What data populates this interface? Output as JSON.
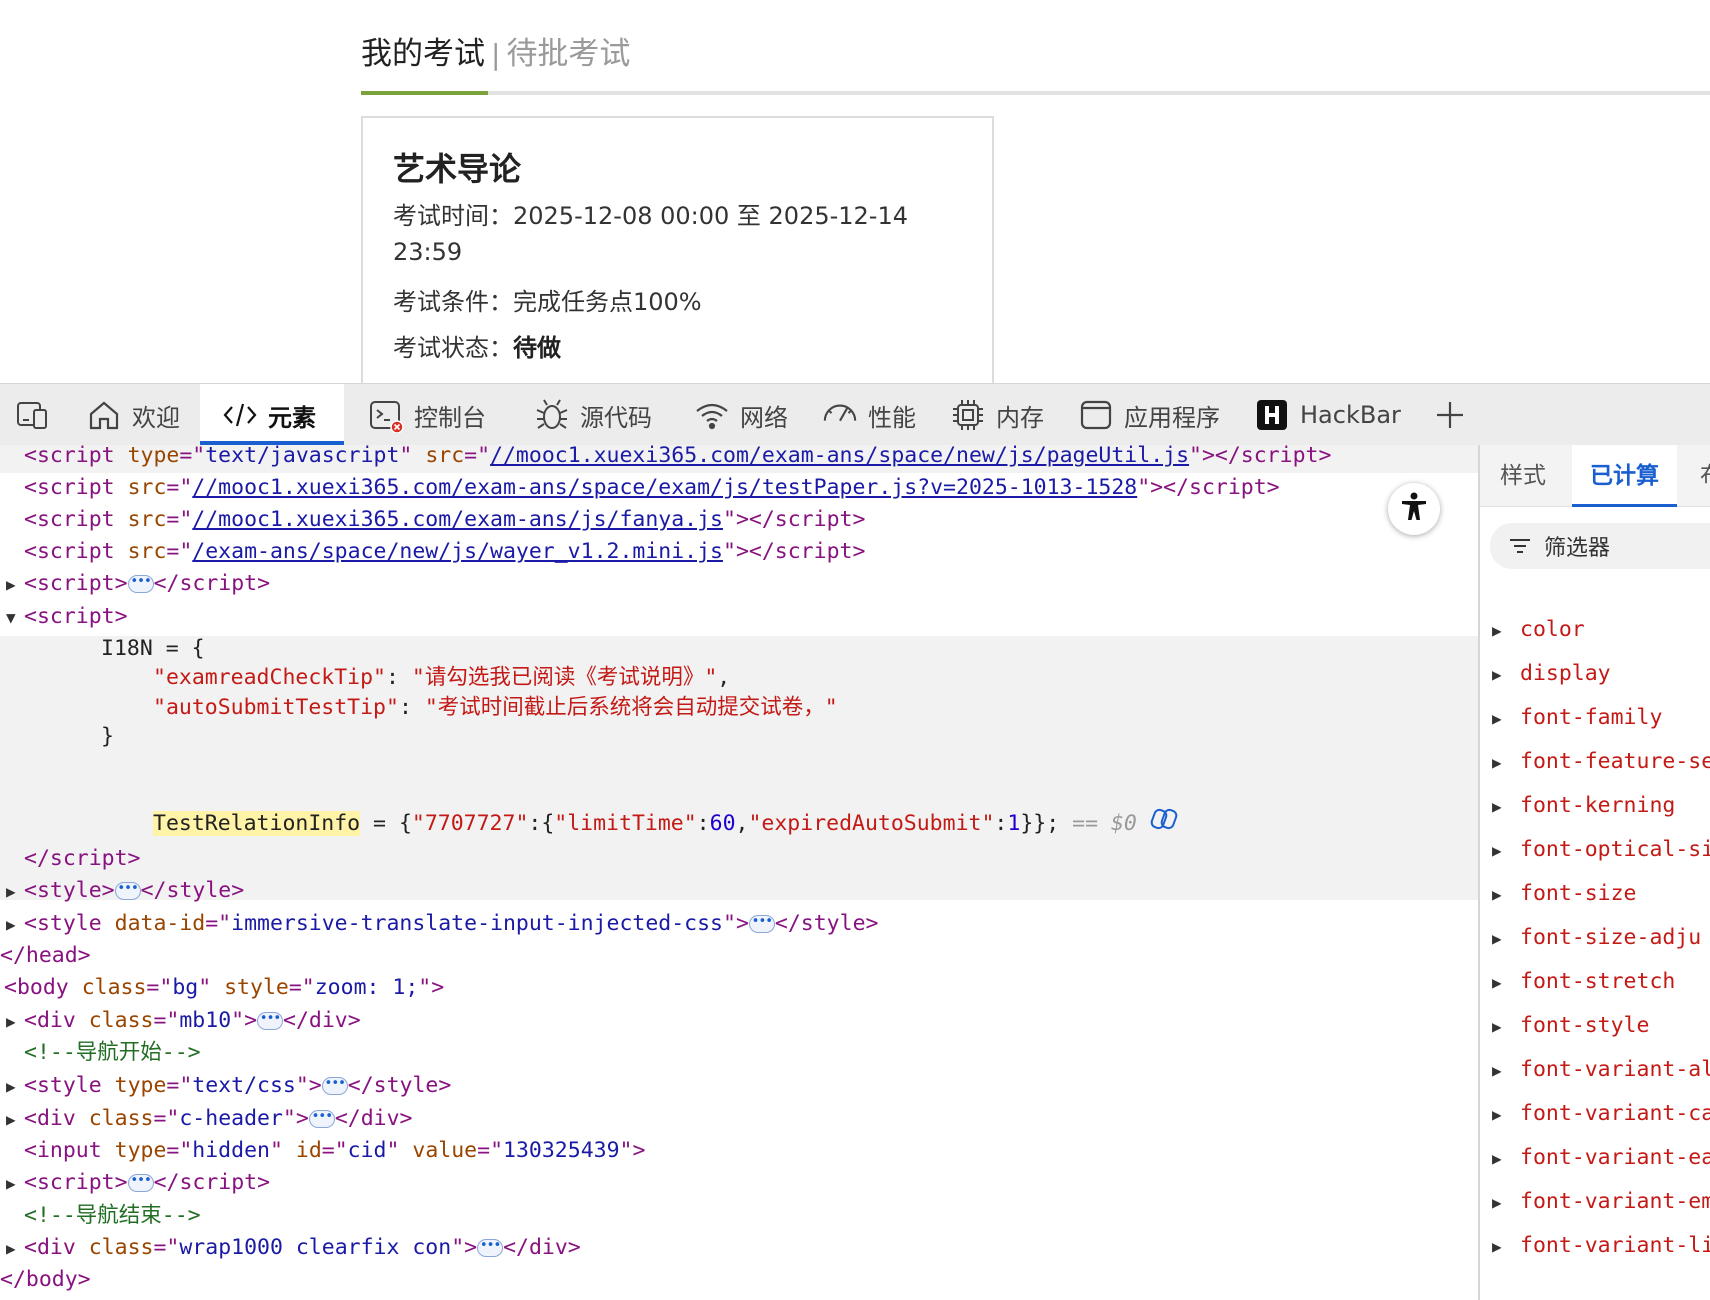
{
  "page": {
    "tab_active": "我的考试",
    "tab_separator": "|",
    "tab_inactive": "待批考试",
    "exam": {
      "title": "艺术导论",
      "time_label": "考试时间：",
      "time_value": "2025-12-08 00:00 至 2025-12-14 23:59",
      "condition_label": "考试条件：",
      "condition_value": "完成任务点100%",
      "status_label": "考试状态：",
      "status_value": "待做"
    }
  },
  "devtools": {
    "toolbar": [
      {
        "label": "欢迎",
        "icon": "home-icon"
      },
      {
        "label": "元素",
        "icon": "code-tag-icon"
      },
      {
        "label": "控制台",
        "icon": "console-icon"
      },
      {
        "label": "源代码",
        "icon": "bug-icon"
      },
      {
        "label": "网络",
        "icon": "wifi-icon"
      },
      {
        "label": "性能",
        "icon": "gauge-icon"
      },
      {
        "label": "内存",
        "icon": "chip-icon"
      },
      {
        "label": "应用程序",
        "icon": "app-window-icon"
      },
      {
        "label": "HackBar",
        "icon": "hackbar-icon"
      }
    ],
    "accent_color": "#1a5fd0",
    "code": {
      "l1_attr1": "type",
      "l1_val1": "text/javascript",
      "l1_attr2": "src",
      "l1_link": "//mooc1.xuexi365.com/exam-ans/space/new/js/pageUtil.js",
      "l2_link": "//mooc1.xuexi365.com/exam-ans/space/exam/js/testPaper.js?v=2025-1013-1528",
      "l3_link": "//mooc1.xuexi365.com/exam-ans/js/fanya.js",
      "l4_link": "/exam-ans/space/new/js/wayer_v1.2.mini.js",
      "i18n_open": "I18N = {",
      "i18n_key1": "\"examreadCheckTip\"",
      "i18n_val1": "\"请勾选我已阅读《考试说明》\"",
      "i18n_key2": "\"autoSubmitTestTip\"",
      "i18n_val2": "\"考试时间截止后系统将会自动提交试卷，\"",
      "i18n_close": "}",
      "tri_name": "TestRelationInfo",
      "tri_rest_1": " = {",
      "tri_k1": "\"7707727\"",
      "tri_k2": "\"limitTime\"",
      "tri_n1": "60",
      "tri_k3": "\"expiredAutoSubmit\"",
      "tri_n2": "1",
      "tri_tail": "}};",
      "tri_ref": "== $0",
      "style_data_id_attr": "data-id",
      "style_data_id_val": "immersive-translate-input-injected-css",
      "body_class": "bg",
      "body_style": "zoom: 1;",
      "div_mb10": "mb10",
      "comment_nav_start": "<!--导航开始-->",
      "style_type": "text/css",
      "div_header": "c-header",
      "input_type": "hidden",
      "input_id": "cid",
      "input_value": "130325439",
      "comment_nav_end": "<!--导航结束-->",
      "div_wrap": "wrap1000 clearfix con"
    },
    "side": {
      "tab_styles": "样式",
      "tab_computed": "已计算",
      "tab_third": "布",
      "filter_label": "筛选器",
      "properties": [
        "color",
        "display",
        "font-family",
        "font-feature-se",
        "font-kerning",
        "font-optical-si",
        "font-size",
        "font-size-adju",
        "font-stretch",
        "font-style",
        "font-variant-al",
        "font-variant-ca",
        "font-variant-ea",
        "font-variant-em",
        "font-variant-li"
      ]
    }
  }
}
